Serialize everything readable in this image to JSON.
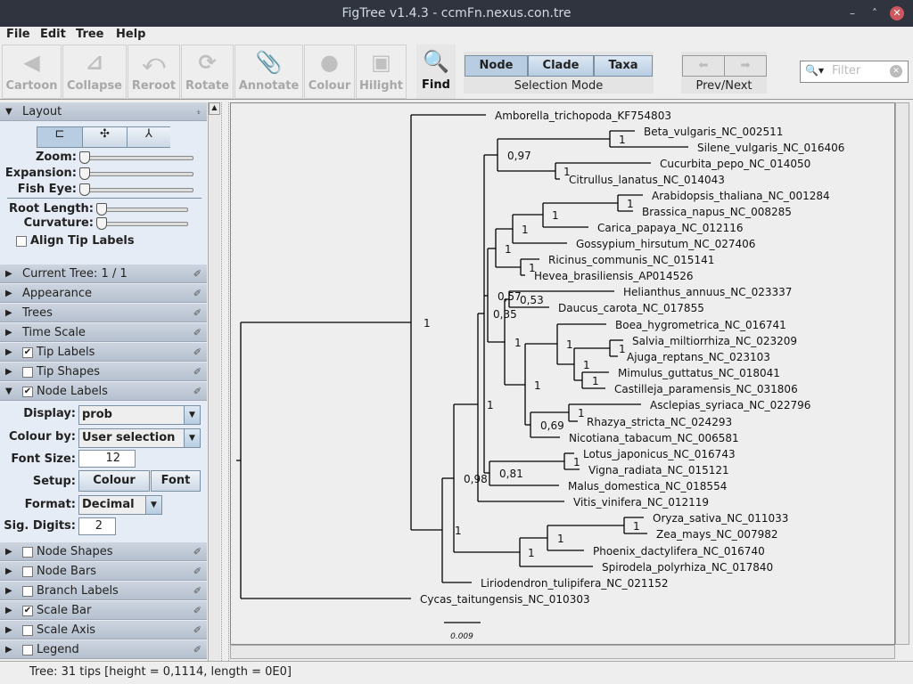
{
  "window": {
    "title": "FigTree v1.4.3 - ccmFn.nexus.con.tre"
  },
  "menu": [
    "File",
    "Edit",
    "Tree",
    "Help"
  ],
  "toolbar": {
    "buttons": [
      "Cartoon",
      "Collapse",
      "Reroot",
      "Rotate",
      "Annotate",
      "Colour",
      "Hilight"
    ],
    "find": "Find",
    "selection_modes": [
      "Node",
      "Clade",
      "Taxa"
    ],
    "selection_active": "Node",
    "selection_label": "Selection Mode",
    "prevnext_label": "Prev/Next",
    "filter_placeholder": "Filter"
  },
  "layout": {
    "title": "Layout",
    "zoom": "Zoom:",
    "expansion": "Expansion:",
    "fisheye": "Fish Eye:",
    "root_length": "Root Length:",
    "curvature": "Curvature:",
    "align_tip_labels": "Align Tip Labels",
    "align_checked": false
  },
  "sections": [
    {
      "label": "Current Tree: 1 / 1",
      "checkbox": null
    },
    {
      "label": "Appearance",
      "checkbox": null
    },
    {
      "label": "Trees",
      "checkbox": null
    },
    {
      "label": "Time Scale",
      "checkbox": null
    },
    {
      "label": "Tip Labels",
      "checkbox": true
    },
    {
      "label": "Tip Shapes",
      "checkbox": false
    },
    {
      "label": "Node Labels",
      "checkbox": true,
      "expanded": true
    }
  ],
  "node_labels_panel": {
    "display_label": "Display:",
    "display": "prob",
    "colour_by_label": "Colour by:",
    "colour_by": "User selection",
    "font_size_label": "Font Size:",
    "font_size": "12",
    "setup_label": "Setup:",
    "colour_btn": "Colour",
    "font_btn": "Font",
    "format_label": "Format:",
    "format": "Decimal",
    "sig_digits_label": "Sig. Digits:",
    "sig_digits": "2"
  },
  "sections_bottom": [
    {
      "label": "Node Shapes",
      "checkbox": false
    },
    {
      "label": "Node Bars",
      "checkbox": false
    },
    {
      "label": "Branch Labels",
      "checkbox": false
    },
    {
      "label": "Scale Bar",
      "checkbox": true
    },
    {
      "label": "Scale Axis",
      "checkbox": false
    },
    {
      "label": "Legend",
      "checkbox": false
    }
  ],
  "tree": {
    "tips": [
      "Amborella_trichopoda_KF754803",
      "Beta_vulgaris_NC_002511",
      "Silene_vulgaris_NC_016406",
      "Cucurbita_pepo_NC_014050",
      "Citrullus_lanatus_NC_014043",
      "Arabidopsis_thaliana_NC_001284",
      "Brassica_napus_NC_008285",
      "Carica_papaya_NC_012116",
      "Gossypium_hirsutum_NC_027406",
      "Ricinus_communis_NC_015141",
      "Hevea_brasiliensis_AP014526",
      "Helianthus_annuus_NC_023337",
      "Daucus_carota_NC_017855",
      "Boea_hygrometrica_NC_016741",
      "Salvia_miltiorrhiza_NC_023209",
      "Ajuga_reptans_NC_023103",
      "Mimulus_guttatus_NC_018041",
      "Castilleja_paramensis_NC_031806",
      "Asclepias_syriaca_NC_022796",
      "Rhazya_stricta_NC_024293",
      "Nicotiana_tabacum_NC_006581",
      "Lotus_japonicus_NC_016743",
      "Vigna_radiata_NC_015121",
      "Malus_domestica_NC_018554",
      "Vitis_vinifera_NC_012119",
      "Oryza_sativa_NC_011033",
      "Zea_mays_NC_007982",
      "Phoenix_dactylifera_NC_016740",
      "Spirodela_polyrhiza_NC_017840",
      "Liriodendron_tulipifera_NC_021152",
      "Cycas_taitungensis_NC_010303"
    ],
    "node_labels": [
      "1",
      "1",
      "0,98",
      "1",
      "1",
      "1",
      "1",
      "0,35",
      "0,97",
      "1",
      "1",
      "0,57",
      "1",
      "1",
      "1",
      "1",
      "1",
      "0,53",
      "1",
      "1",
      "1",
      "1",
      "1",
      "0,69",
      "1",
      "0,81",
      "1"
    ],
    "scale_bar": "0.009"
  },
  "status": "Tree: 31 tips [height = 0,1114, length = 0E0]"
}
